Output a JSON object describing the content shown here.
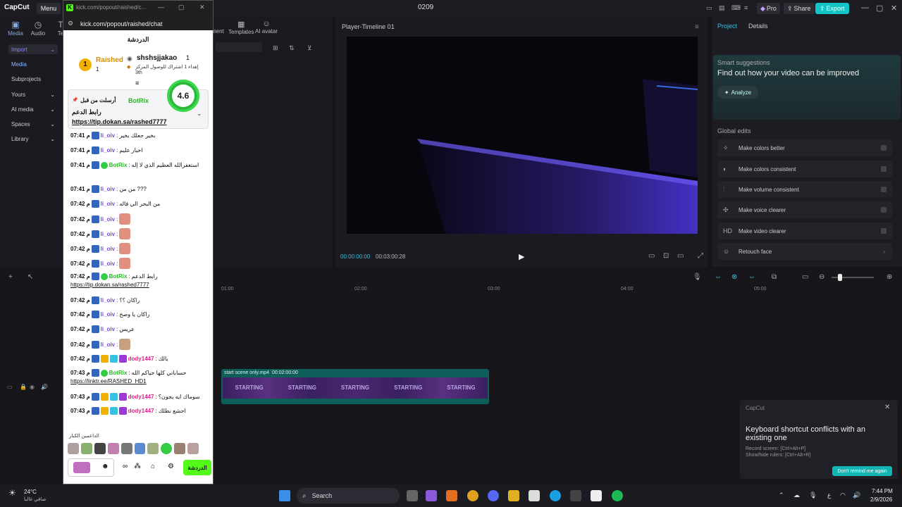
{
  "app": {
    "logo": "CapCut",
    "menu_label": "Menu",
    "project_title": "0209",
    "pro_label": "Pro",
    "share_label": "Share",
    "export_label": "Export"
  },
  "left_tabs": [
    {
      "label": "Media"
    },
    {
      "label": "Audio"
    },
    {
      "label": "Te"
    }
  ],
  "left_sidebar": [
    {
      "label": "Import"
    },
    {
      "label": "Media"
    },
    {
      "label": "Subprojects"
    },
    {
      "label": "Yours"
    },
    {
      "label": "AI media"
    },
    {
      "label": "Spaces"
    },
    {
      "label": "Library"
    }
  ],
  "media_tabs": [
    {
      "label": "ment"
    },
    {
      "label": "Templates"
    },
    {
      "label": "AI avatar"
    }
  ],
  "player": {
    "title": "Player-Timeline 01",
    "current_time": "00:00:00:00",
    "total_time": "00:03:00:28"
  },
  "right_panel": {
    "tab_project": "Project",
    "tab_details": "Details",
    "smart_title": "Smart suggestions",
    "smart_sub": "Find out how your video can be improved",
    "analyze_label": "Analyze",
    "global_edits_title": "Global edits",
    "global_edits": [
      {
        "label": "Make colors better",
        "icon": "sparkle-icon"
      },
      {
        "label": "Make colors consistent",
        "icon": "palette-icon"
      },
      {
        "label": "Make volume consistent",
        "icon": "volume-icon"
      },
      {
        "label": "Make voice clearer",
        "icon": "voice-icon"
      },
      {
        "label": "Make video clearer",
        "icon": "hd-icon"
      },
      {
        "label": "Retouch face",
        "icon": "face-icon"
      }
    ]
  },
  "timeline": {
    "ruler": [
      "01:00",
      "02:00",
      "03:00",
      "04:00",
      "05:00"
    ],
    "clip_label": "start scene only.mp4",
    "clip_duration": "00:02:00:00",
    "clip_frame_text": "STARTING"
  },
  "toast": {
    "app": "CapCut",
    "title": "Keyboard shortcut conflicts with an existing one",
    "line1": "Record screen: [Ctrl+Alt+P]",
    "line2": "Show/hide rulers: [Ctrl+Alt+R]",
    "button": "Don't remind me again"
  },
  "chat_window": {
    "title_url": "kick.com/popout/raished/c...",
    "url": "kick.com/popout/raished/chat",
    "header": "الدردشة",
    "top_user": "Raished",
    "top_user_count": "1",
    "rank": "1",
    "gift_user": "shshsjjakao",
    "gift_count": "1",
    "gift_text": "إهداء 1 اشتراك للوصول المركز",
    "gift_rank": "3th",
    "rating": "4.6",
    "pinned_by": "أرسلت من قبل",
    "pinned_user": "BotRix",
    "pinned_title": "رابط الدعم",
    "pinned_link": "https://tip.dokan.sa/rashed7777",
    "messages": [
      {
        "time": "07:41 م",
        "user": "li_oiv",
        "text": "بخير جعلك بخير",
        "kind": "li"
      },
      {
        "time": "07:41 م",
        "user": "li_oiv",
        "text": "اخبار عليم",
        "kind": "li"
      },
      {
        "time": "07:41 م",
        "user": "BotRix",
        "text": "استغفرالله العظيم الذي لا إله",
        "kind": "bot"
      },
      {
        "time": "07:41 م",
        "user": "li_oiv",
        "text": "من من ???",
        "kind": "li"
      },
      {
        "time": "07:42 م",
        "user": "li_oiv",
        "text": "من البحر الي قاله",
        "kind": "li"
      },
      {
        "time": "07:42 م",
        "user": "li_oiv",
        "text": "",
        "kind": "li"
      },
      {
        "time": "07:42 م",
        "user": "li_oiv",
        "text": "",
        "kind": "li"
      },
      {
        "time": "07:42 م",
        "user": "li_oiv",
        "text": "",
        "kind": "li"
      },
      {
        "time": "07:42 م",
        "user": "li_oiv",
        "text": "",
        "kind": "li"
      },
      {
        "time": "07:42 م",
        "user": "BotRix",
        "text": "رابط الدعم",
        "kind": "bot"
      },
      {
        "time": "07:42 م",
        "user": "li_oiv",
        "text": "راكان ؟؟",
        "kind": "li"
      },
      {
        "time": "07:42 م",
        "user": "li_oiv",
        "text": "راكان يا وصخ",
        "kind": "li"
      },
      {
        "time": "07:42 م",
        "user": "li_oiv",
        "text": "عريس",
        "kind": "li"
      },
      {
        "time": "07:42 م",
        "user": "li_oiv",
        "text": "",
        "kind": "li"
      },
      {
        "time": "07:42 م",
        "user": "dody1447",
        "text": "بالك",
        "kind": "dody"
      },
      {
        "time": "07:43 م",
        "user": "BotRix",
        "text": "حساباتي كلها حياكم الله",
        "kind": "bot"
      },
      {
        "time": "07:43 م",
        "user": "dody1447",
        "text": "سوماك ايه يجون؟",
        "kind": "dody"
      },
      {
        "time": "07:43 م",
        "user": "dody1447",
        "text": "احشع نطلك",
        "kind": "dody"
      }
    ],
    "link_1": "https://tip.dokan.sa/rashed7777",
    "link_2": "https://linktr.ee/RASHED_HD1",
    "supporters_label": "الداعمين الكبار",
    "chat_button": "الدردشة"
  },
  "taskbar": {
    "temp": "24°C",
    "weather": "صافي غالبا",
    "search": "Search",
    "time": "7:44 PM",
    "date": "2/9/2026"
  }
}
